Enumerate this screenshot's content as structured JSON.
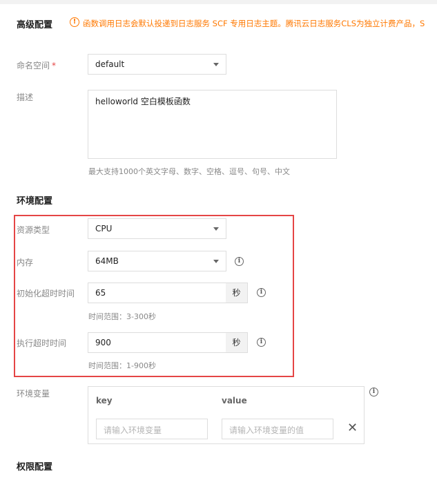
{
  "advanced": {
    "title": "高级配置",
    "notice": "函数调用日志会默认投递到日志服务 SCF 专用日志主题。腾讯云日志服务CLS为独立计费产品，S"
  },
  "namespace": {
    "label": "命名空间",
    "required_mark": "*",
    "value": "default"
  },
  "description": {
    "label": "描述",
    "value": "helloworld 空白模板函数",
    "hint": "最大支持1000个英文字母、数字、空格、逗号、句号、中文"
  },
  "env_config": {
    "title": "环境配置",
    "resource_type": {
      "label": "资源类型",
      "value": "CPU"
    },
    "memory": {
      "label": "内存",
      "value": "64MB"
    },
    "init_timeout": {
      "label": "初始化超时时间",
      "value": "65",
      "unit": "秒",
      "hint": "时间范围：3-300秒"
    },
    "exec_timeout": {
      "label": "执行超时时间",
      "value": "900",
      "unit": "秒",
      "hint": "时间范围：1-900秒"
    }
  },
  "env_vars": {
    "label": "环境变量",
    "key_header": "key",
    "value_header": "value",
    "key_placeholder": "请输入环境变量",
    "value_placeholder": "请输入环境变量的值"
  },
  "permissions": {
    "title": "权限配置"
  },
  "icons": {
    "info": "info-icon",
    "warning": "warning-icon",
    "close": "close-icon",
    "dropdown": "chevron-down-icon"
  },
  "colors": {
    "warning": "#ff7800",
    "highlight": "#e54545"
  }
}
